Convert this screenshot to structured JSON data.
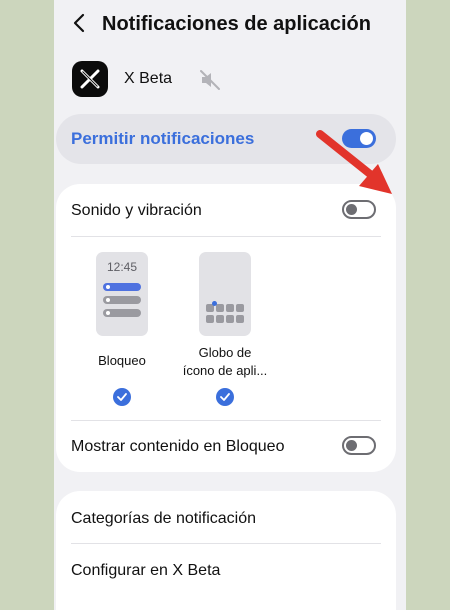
{
  "header": {
    "title": "Notificaciones de aplicación",
    "back_icon": "chevron-left-icon"
  },
  "app": {
    "name": "X Beta",
    "icon": "x-logo-icon",
    "mute_icon": "muted-speaker-icon"
  },
  "allow_notifications": {
    "label": "Permitir notificaciones",
    "enabled": true
  },
  "sound_vibration": {
    "label": "Sonido y vibración",
    "enabled": false
  },
  "styles": [
    {
      "label": "Bloqueo",
      "preview_time": "12:45",
      "selected": true
    },
    {
      "label_line1": "Globo de",
      "label_line2": "ícono de apli...",
      "selected": true
    }
  ],
  "show_content_lock": {
    "label": "Mostrar contenido en Bloqueo",
    "enabled": false
  },
  "menu": {
    "categories": "Categorías de notificación",
    "configure": "Configurar en X Beta"
  },
  "colors": {
    "accent": "#3b6fdc",
    "annotation_arrow": "#e2342b",
    "background": "#ccd6bd"
  }
}
